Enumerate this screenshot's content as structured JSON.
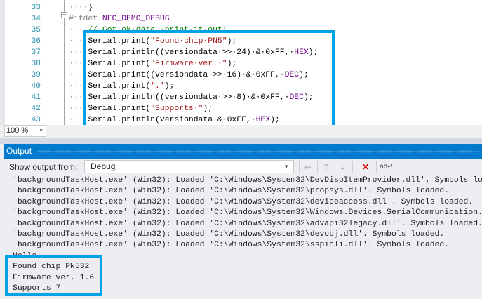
{
  "editor": {
    "lines": [
      {
        "num": "33",
        "segs": [
          {
            "t": "····",
            "c": "ws"
          },
          {
            "t": "}",
            "c": "pl"
          }
        ]
      },
      {
        "num": "34",
        "segs": [
          {
            "t": "#ifdef",
            "c": "kw"
          },
          {
            "t": "·",
            "c": "ws"
          },
          {
            "t": "NFC_DEMO_DEBUG",
            "c": "mac"
          }
        ]
      },
      {
        "num": "35",
        "segs": [
          {
            "t": "····",
            "c": "ws"
          },
          {
            "t": "//·Got·ok·data,·print·it·out!",
            "c": "cm"
          }
        ]
      },
      {
        "num": "36",
        "segs": [
          {
            "t": "····",
            "c": "ws"
          },
          {
            "t": "Serial.print(",
            "c": "pl"
          },
          {
            "t": "\"Found·chip·PN5\"",
            "c": "str"
          },
          {
            "t": ");",
            "c": "pl"
          }
        ]
      },
      {
        "num": "37",
        "segs": [
          {
            "t": "····",
            "c": "ws"
          },
          {
            "t": "Serial.println((versiondata·>>·24)·&·0xFF,·",
            "c": "pl"
          },
          {
            "t": "HEX",
            "c": "mac"
          },
          {
            "t": ");",
            "c": "pl"
          }
        ]
      },
      {
        "num": "38",
        "segs": [
          {
            "t": "····",
            "c": "ws"
          },
          {
            "t": "Serial.print(",
            "c": "pl"
          },
          {
            "t": "\"Firmware·ver.·\"",
            "c": "str"
          },
          {
            "t": ");",
            "c": "pl"
          }
        ]
      },
      {
        "num": "39",
        "segs": [
          {
            "t": "····",
            "c": "ws"
          },
          {
            "t": "Serial.print((versiondata·>>·16)·&·0xFF,·",
            "c": "pl"
          },
          {
            "t": "DEC",
            "c": "mac"
          },
          {
            "t": ");",
            "c": "pl"
          }
        ]
      },
      {
        "num": "40",
        "segs": [
          {
            "t": "····",
            "c": "ws"
          },
          {
            "t": "Serial.print(",
            "c": "pl"
          },
          {
            "t": "'.'",
            "c": "str"
          },
          {
            "t": ");",
            "c": "pl"
          }
        ]
      },
      {
        "num": "41",
        "segs": [
          {
            "t": "····",
            "c": "ws"
          },
          {
            "t": "Serial.println((versiondata·>>·8)·&·0xFF,·",
            "c": "pl"
          },
          {
            "t": "DEC",
            "c": "mac"
          },
          {
            "t": ");",
            "c": "pl"
          }
        ]
      },
      {
        "num": "42",
        "segs": [
          {
            "t": "····",
            "c": "ws"
          },
          {
            "t": "Serial.print(",
            "c": "pl"
          },
          {
            "t": "\"Supports·\"",
            "c": "str"
          },
          {
            "t": ");",
            "c": "pl"
          }
        ]
      },
      {
        "num": "43",
        "segs": [
          {
            "t": "····",
            "c": "ws"
          },
          {
            "t": "Serial.println(versiondata·&·0xFF,·",
            "c": "pl"
          },
          {
            "t": "HEX",
            "c": "mac"
          },
          {
            "t": ");",
            "c": "pl"
          }
        ]
      }
    ],
    "zoom": "100 %",
    "highlight_color": "#00a2e8"
  },
  "output": {
    "title": "Output",
    "show_from_label": "Show output from:",
    "show_from_value": "Debug",
    "lines": [
      "'backgroundTaskHost.exe' (Win32): Loaded 'C:\\Windows\\System32\\DevDispItemProvider.dll'. Symbols loaded.",
      "'backgroundTaskHost.exe' (Win32): Loaded 'C:\\Windows\\System32\\propsys.dll'. Symbols loaded.",
      "'backgroundTaskHost.exe' (Win32): Loaded 'C:\\Windows\\System32\\deviceaccess.dll'. Symbols loaded.",
      "'backgroundTaskHost.exe' (Win32): Loaded 'C:\\Windows\\System32\\Windows.Devices.SerialCommunication.dll'. Symbols loaded.",
      "'backgroundTaskHost.exe' (Win32): Loaded 'C:\\Windows\\System32\\advapi32legacy.dll'. Symbols loaded.",
      "'backgroundTaskHost.exe' (Win32): Loaded 'C:\\Windows\\System32\\devobj.dll'. Symbols loaded.",
      "'backgroundTaskHost.exe' (Win32): Loaded 'C:\\Windows\\System32\\sspicli.dll'. Symbols loaded.",
      "Hello!",
      "Found chip PN532",
      "Firmware ver. 1.6",
      "Supports 7"
    ]
  }
}
